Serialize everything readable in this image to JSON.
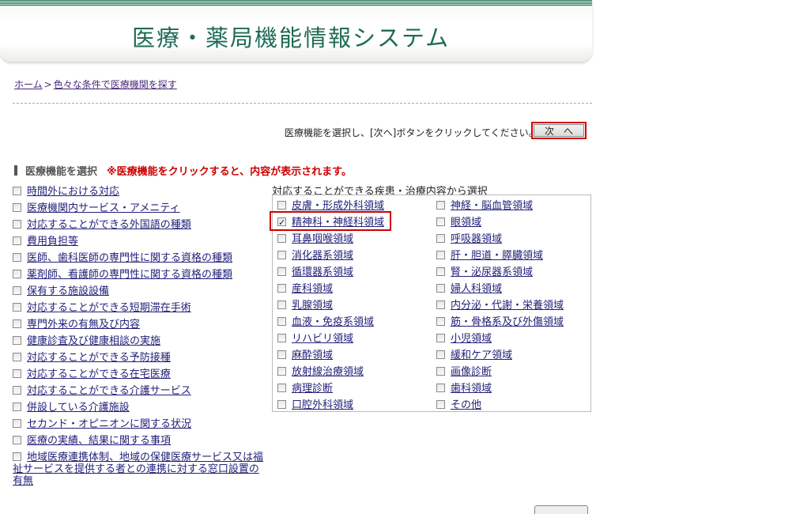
{
  "header": {
    "title": "医療・薬局機能情報システム"
  },
  "breadcrumb": {
    "home": "ホーム",
    "separator": ">",
    "current": "色々な条件で医療機関を探す"
  },
  "instruction": "医療機能を選択し、[次へ]ボタンをクリックしてください。→",
  "next_button": "次　へ",
  "section": {
    "title": "医療機能を選択",
    "note": "※医療機能をクリックすると、内容が表示されます。"
  },
  "left_items": [
    "時間外における対応",
    "医療機関内サービス・アメニティ",
    "対応することができる外国語の種類",
    "費用負担等",
    "医師、歯科医師の専門性に関する資格の種類",
    "薬剤師、看護師の専門性に関する資格の種類",
    "保有する施設設備",
    "対応することができる短期滞在手術",
    "専門外来の有無及び内容",
    "健康診査及び健康相談の実施",
    "対応することができる予防接種",
    "対応することができる在宅医療",
    "対応することができる介護サービス",
    "併設している介護施設",
    "セカンド・オピニオンに関する状況",
    "医療の実績、結果に関する事項",
    "地域医療連携体制、地域の保健医療サービス又は福祉サービスを提供する者との連携に対する窓口設置の有無"
  ],
  "right_caption": "対応することができる疾患・治療内容から選択",
  "right_col1": [
    {
      "label": "皮膚・形成外科領域",
      "checked": false
    },
    {
      "label": "精神科・神経科領域",
      "checked": true
    },
    {
      "label": "耳鼻咽喉領域",
      "checked": false
    },
    {
      "label": "消化器系領域",
      "checked": false
    },
    {
      "label": "循環器系領域",
      "checked": false
    },
    {
      "label": "産科領域",
      "checked": false
    },
    {
      "label": "乳腺領域",
      "checked": false
    },
    {
      "label": "血液・免疫系領域",
      "checked": false
    },
    {
      "label": "リハビリ領域",
      "checked": false
    },
    {
      "label": "麻酔領域",
      "checked": false
    },
    {
      "label": "放射線治療領域",
      "checked": false
    },
    {
      "label": "病理診断",
      "checked": false
    },
    {
      "label": "口腔外科領域",
      "checked": false
    }
  ],
  "right_col2": [
    {
      "label": "神経・脳血管領域",
      "checked": false
    },
    {
      "label": "眼領域",
      "checked": false
    },
    {
      "label": "呼吸器領域",
      "checked": false
    },
    {
      "label": "肝・胆道・膵臓領域",
      "checked": false
    },
    {
      "label": "腎・泌尿器系領域",
      "checked": false
    },
    {
      "label": "婦人科領域",
      "checked": false
    },
    {
      "label": "内分泌・代謝・栄養領域",
      "checked": false
    },
    {
      "label": "筋・骨格系及び外傷領域",
      "checked": false
    },
    {
      "label": "小児領域",
      "checked": false
    },
    {
      "label": "緩和ケア領域",
      "checked": false
    },
    {
      "label": "画像診断",
      "checked": false
    },
    {
      "label": "歯科領域",
      "checked": false
    },
    {
      "label": "その他",
      "checked": false
    }
  ]
}
